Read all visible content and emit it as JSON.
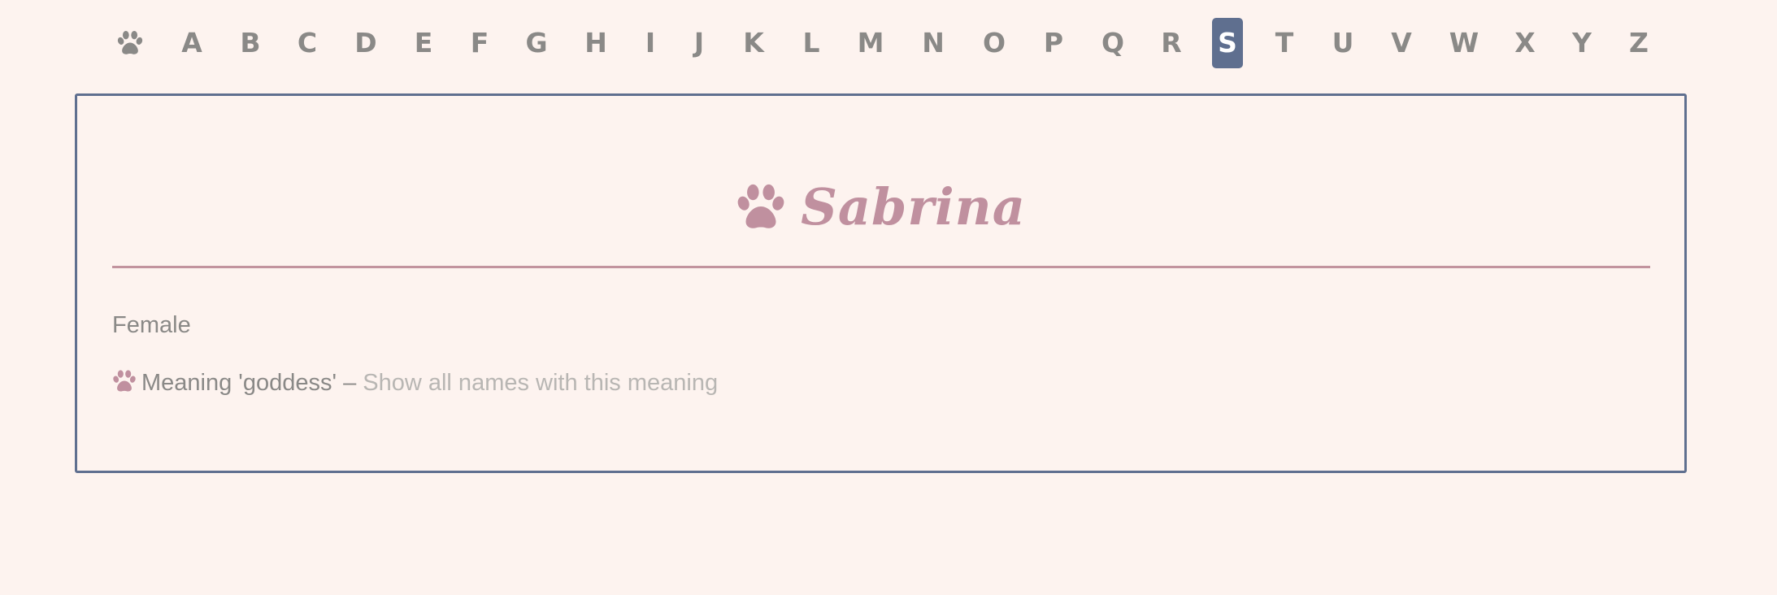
{
  "nav": {
    "home_icon": "paw-icon",
    "letters": [
      "A",
      "B",
      "C",
      "D",
      "E",
      "F",
      "G",
      "H",
      "I",
      "J",
      "K",
      "L",
      "M",
      "N",
      "O",
      "P",
      "Q",
      "R",
      "S",
      "T",
      "U",
      "V",
      "W",
      "X",
      "Y",
      "Z"
    ],
    "active_letter": "S"
  },
  "name_card": {
    "title_icon": "paw-icon",
    "name": "Sabrina",
    "gender": "Female",
    "meaning_icon": "paw-icon",
    "meaning_text": "Meaning 'goddess'",
    "meaning_separator": " – ",
    "meaning_link_label": "Show all names with this meaning"
  },
  "colors": {
    "background": "#fdf3ef",
    "accent_blue": "#5f6f8f",
    "accent_pink": "#c0909f",
    "text_gray": "#8a8987",
    "link_gray": "#b8b6b3"
  }
}
